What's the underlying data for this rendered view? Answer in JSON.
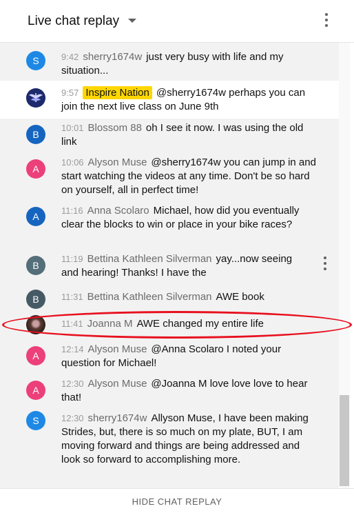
{
  "header": {
    "title": "Live chat replay",
    "menu_icon": "more-vert-icon"
  },
  "messages": [
    {
      "time": "9:42",
      "author": "sherry1674w",
      "text": "just very busy with life and my situation...",
      "avatar_letter": "S",
      "avatar_color": "#1e88e5",
      "avatar_kind": "letter",
      "owner": false
    },
    {
      "time": "9:57",
      "author": "Inspire Nation",
      "text": "@sherry1674w perhaps you can join the next live class on June 9th",
      "avatar_letter": "",
      "avatar_color": "#1d2a6b",
      "avatar_kind": "emblem",
      "owner": true
    },
    {
      "time": "10:01",
      "author": "Blossom 88",
      "text": "oh I see it now. I was using the old link",
      "avatar_letter": "B",
      "avatar_color": "#1565c0",
      "avatar_kind": "letter",
      "owner": false
    },
    {
      "time": "10:06",
      "author": "Alyson Muse",
      "text": "@sherry1674w you can jump in and start watching the videos at any time. Don't be so hard on yourself, all in perfect time!",
      "avatar_letter": "A",
      "avatar_color": "#ec407a",
      "avatar_kind": "letter",
      "owner": false
    },
    {
      "time": "11:16",
      "author": "Anna Scolaro",
      "text": "Michael, how did you eventually clear the blocks to win or place in your bike races?",
      "avatar_letter": "A",
      "avatar_color": "#1565c0",
      "avatar_kind": "letter",
      "owner": false
    },
    {
      "time": "11:19",
      "author": "Bettina Kathleen Silverman",
      "text": "yay...now seeing and hearing! Thanks! I have the",
      "avatar_letter": "B",
      "avatar_color": "#546e7a",
      "avatar_kind": "letter",
      "owner": false
    },
    {
      "time": "11:31",
      "author": "Bettina Kathleen Silverman",
      "text": "AWE book",
      "avatar_letter": "B",
      "avatar_color": "#455a64",
      "avatar_kind": "letter",
      "owner": false
    },
    {
      "time": "11:41",
      "author": "Joanna M",
      "text": "AWE changed my entire life",
      "avatar_letter": "",
      "avatar_color": "#3e2723",
      "avatar_kind": "photo",
      "owner": false
    },
    {
      "time": "12:14",
      "author": "Alyson Muse",
      "text": "@Anna Scolaro I noted your question for Michael!",
      "avatar_letter": "A",
      "avatar_color": "#ec407a",
      "avatar_kind": "letter",
      "owner": false
    },
    {
      "time": "12:30",
      "author": "Alyson Muse",
      "text": "@Joanna M love love love to hear that!",
      "avatar_letter": "A",
      "avatar_color": "#ec407a",
      "avatar_kind": "letter",
      "owner": false
    },
    {
      "time": "12:30",
      "author": "sherry1674w",
      "text": "Allyson Muse, I have been making Strides, but, there is so much on my plate, BUT, I am moving forward and things are being addressed and look so forward to accomplishing more.",
      "avatar_letter": "S",
      "avatar_color": "#1e88e5",
      "avatar_kind": "letter",
      "owner": false
    }
  ],
  "footer": {
    "hide_label": "HIDE CHAT REPLAY"
  },
  "annotation_color": "#e8101e"
}
